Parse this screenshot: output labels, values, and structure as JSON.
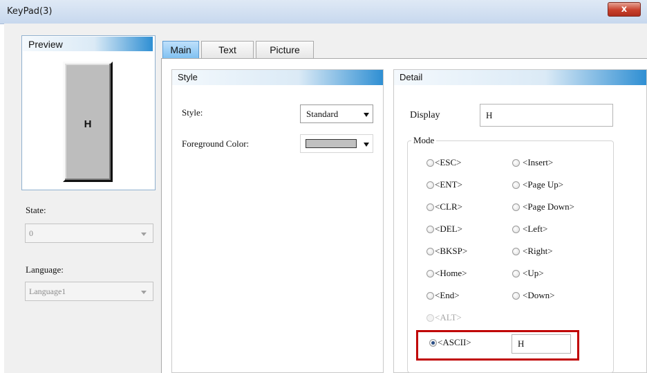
{
  "window": {
    "title": "KeyPad(3)",
    "close_glyph": "x"
  },
  "preview": {
    "title": "Preview",
    "key_label": "H"
  },
  "state": {
    "label": "State:",
    "value": "0"
  },
  "language": {
    "label": "Language:",
    "value": "Language1"
  },
  "tabs": [
    {
      "label": "Main",
      "selected": true
    },
    {
      "label": "Text",
      "selected": false
    },
    {
      "label": "Picture",
      "selected": false
    }
  ],
  "style_group": {
    "title": "Style",
    "style_label": "Style:",
    "style_value": "Standard",
    "fg_label": "Foreground Color:",
    "fg_color": "#c0c0c0"
  },
  "detail_group": {
    "title": "Detail",
    "display_label": "Display",
    "display_value": "H",
    "mode_label": "Mode",
    "modes_left": [
      "<ESC>",
      "<ENT>",
      "<CLR>",
      "<DEL>",
      "<BKSP>",
      "<Home>",
      "<End>"
    ],
    "modes_right": [
      "<Insert>",
      "<Page Up>",
      "<Page Down>",
      "<Left>",
      "<Right>",
      "<Up>",
      "<Down>"
    ],
    "alt_label": "<ALT>",
    "ascii_label": "<ASCII>",
    "ascii_value": "H",
    "selected_mode": "<ASCII>"
  },
  "colors": {
    "accent_blue": "#2f8fd3",
    "highlight_red": "#c00000"
  }
}
